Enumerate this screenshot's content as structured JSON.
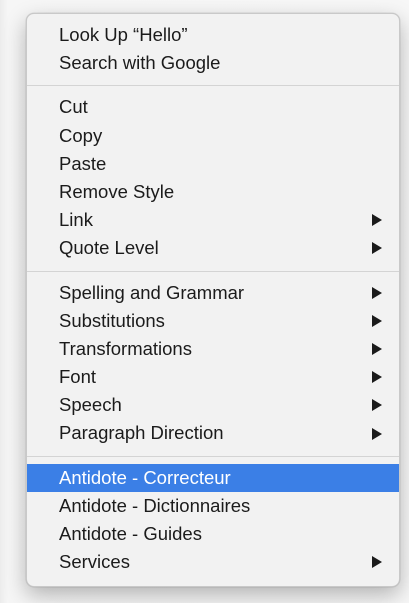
{
  "menu": {
    "group1": [
      {
        "label": "Look Up “Hello”",
        "submenu": false
      },
      {
        "label": "Search with Google",
        "submenu": false
      }
    ],
    "group2": [
      {
        "label": "Cut",
        "submenu": false
      },
      {
        "label": "Copy",
        "submenu": false
      },
      {
        "label": "Paste",
        "submenu": false
      },
      {
        "label": "Remove Style",
        "submenu": false
      },
      {
        "label": "Link",
        "submenu": true
      },
      {
        "label": "Quote Level",
        "submenu": true
      }
    ],
    "group3": [
      {
        "label": "Spelling and Grammar",
        "submenu": true
      },
      {
        "label": "Substitutions",
        "submenu": true
      },
      {
        "label": "Transformations",
        "submenu": true
      },
      {
        "label": "Font",
        "submenu": true
      },
      {
        "label": "Speech",
        "submenu": true
      },
      {
        "label": "Paragraph Direction",
        "submenu": true
      }
    ],
    "group4": [
      {
        "label": "Antidote - Correcteur",
        "submenu": false,
        "selected": true
      },
      {
        "label": "Antidote - Dictionnaires",
        "submenu": false
      },
      {
        "label": "Antidote - Guides",
        "submenu": false
      },
      {
        "label": "Services",
        "submenu": true
      }
    ]
  },
  "colors": {
    "highlight": "#3b7fe6",
    "menu_background": "#f2f2f2",
    "text": "#1b1b1b"
  },
  "icons": {
    "submenu": "chevron-right-icon"
  }
}
